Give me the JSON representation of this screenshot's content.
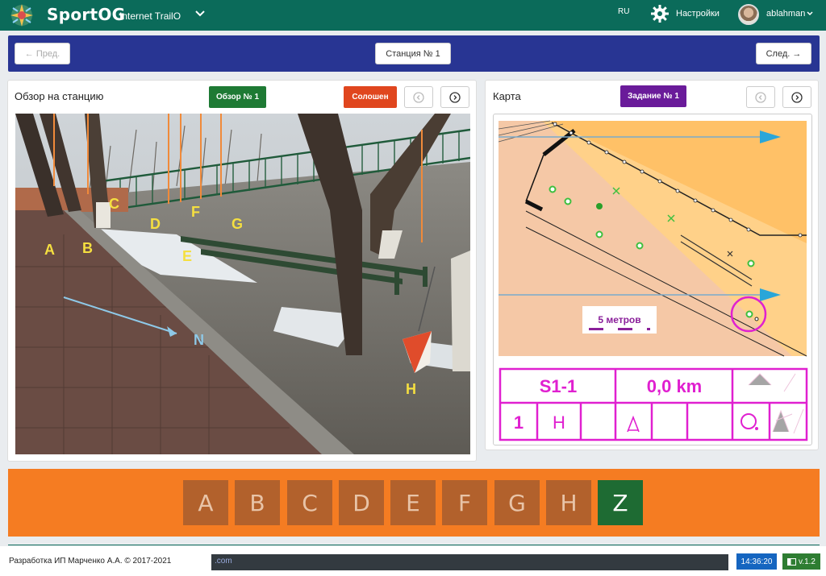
{
  "header": {
    "brand": "SportOG",
    "brand_sub": "Internet TrailO",
    "lang": "RU",
    "settings": "Настройки",
    "user": "ablahman"
  },
  "station_nav": {
    "prev": "← Пред.",
    "station": "Станция № 1",
    "next": "След. →"
  },
  "overview": {
    "title": "Обзор на станцию",
    "view_tag": "Обзор № 1",
    "zero_tag": "Солошен",
    "photo_labels": [
      "A",
      "B",
      "C",
      "D",
      "E",
      "F",
      "G",
      "H",
      "N"
    ]
  },
  "map": {
    "title": "Карта",
    "task_tag": "Задание № 1",
    "scale": "5 метров",
    "control_code": "S1-1",
    "distance": "0,0 km",
    "row_num": "1",
    "row_letter": "H"
  },
  "answers": [
    "A",
    "B",
    "C",
    "D",
    "E",
    "F",
    "G",
    "H",
    "Z"
  ],
  "footer": {
    "copyright": "Разработка ИП Марченко А.А. © 2017-2021",
    "console": ".com",
    "time": "14:36:20",
    "version": "v.1.2"
  },
  "colors": {
    "topbar": "#0b6b5a",
    "station_bar": "#283593",
    "view_tag": "#1e7a34",
    "zero_tag": "#e0461e",
    "task_tag": "#6a1b9a",
    "answer_bar": "#f57c22",
    "answer_z": "#1e6b33"
  }
}
